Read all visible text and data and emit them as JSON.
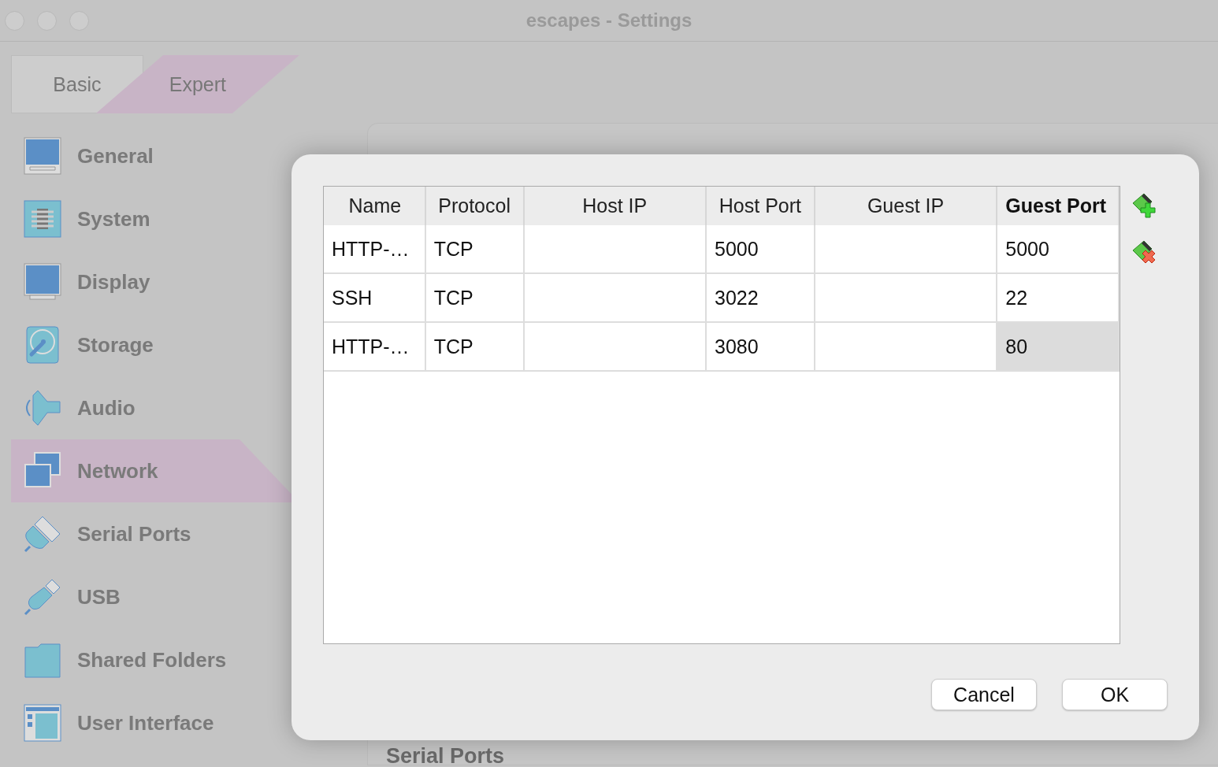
{
  "window": {
    "title": "escapes - Settings"
  },
  "mode_tabs": [
    {
      "label": "Basic",
      "selected": false
    },
    {
      "label": "Expert",
      "selected": true
    }
  ],
  "sidebar": {
    "items": [
      {
        "label": "General",
        "selected": false
      },
      {
        "label": "System",
        "selected": false
      },
      {
        "label": "Display",
        "selected": false
      },
      {
        "label": "Storage",
        "selected": false
      },
      {
        "label": "Audio",
        "selected": false
      },
      {
        "label": "Network",
        "selected": true
      },
      {
        "label": "Serial Ports",
        "selected": false
      },
      {
        "label": "USB",
        "selected": false
      },
      {
        "label": "Shared Folders",
        "selected": false
      },
      {
        "label": "User Interface",
        "selected": false
      }
    ]
  },
  "background_panel": {
    "lower_heading": "Serial Ports"
  },
  "dialog": {
    "table": {
      "columns": [
        {
          "label": "Name",
          "sorted": false
        },
        {
          "label": "Protocol",
          "sorted": false
        },
        {
          "label": "Host IP",
          "sorted": false
        },
        {
          "label": "Host Port",
          "sorted": false
        },
        {
          "label": "Guest IP",
          "sorted": false
        },
        {
          "label": "Guest Port",
          "sorted": true
        }
      ],
      "rows": [
        {
          "cells": [
            {
              "text": "HTTP-…",
              "selected": false
            },
            {
              "text": "TCP",
              "selected": false
            },
            {
              "text": "",
              "selected": false
            },
            {
              "text": "5000",
              "selected": false
            },
            {
              "text": "",
              "selected": false
            },
            {
              "text": "5000",
              "selected": false
            }
          ]
        },
        {
          "cells": [
            {
              "text": "SSH",
              "selected": false
            },
            {
              "text": "TCP",
              "selected": false
            },
            {
              "text": "",
              "selected": false
            },
            {
              "text": "3022",
              "selected": false
            },
            {
              "text": "",
              "selected": false
            },
            {
              "text": "22",
              "selected": false
            }
          ]
        },
        {
          "cells": [
            {
              "text": "HTTP-…",
              "selected": false
            },
            {
              "text": "TCP",
              "selected": false
            },
            {
              "text": "",
              "selected": false
            },
            {
              "text": "3080",
              "selected": false
            },
            {
              "text": "",
              "selected": false
            },
            {
              "text": "80",
              "selected": true
            }
          ]
        }
      ]
    },
    "buttons": [
      "Cancel",
      "OK"
    ]
  }
}
